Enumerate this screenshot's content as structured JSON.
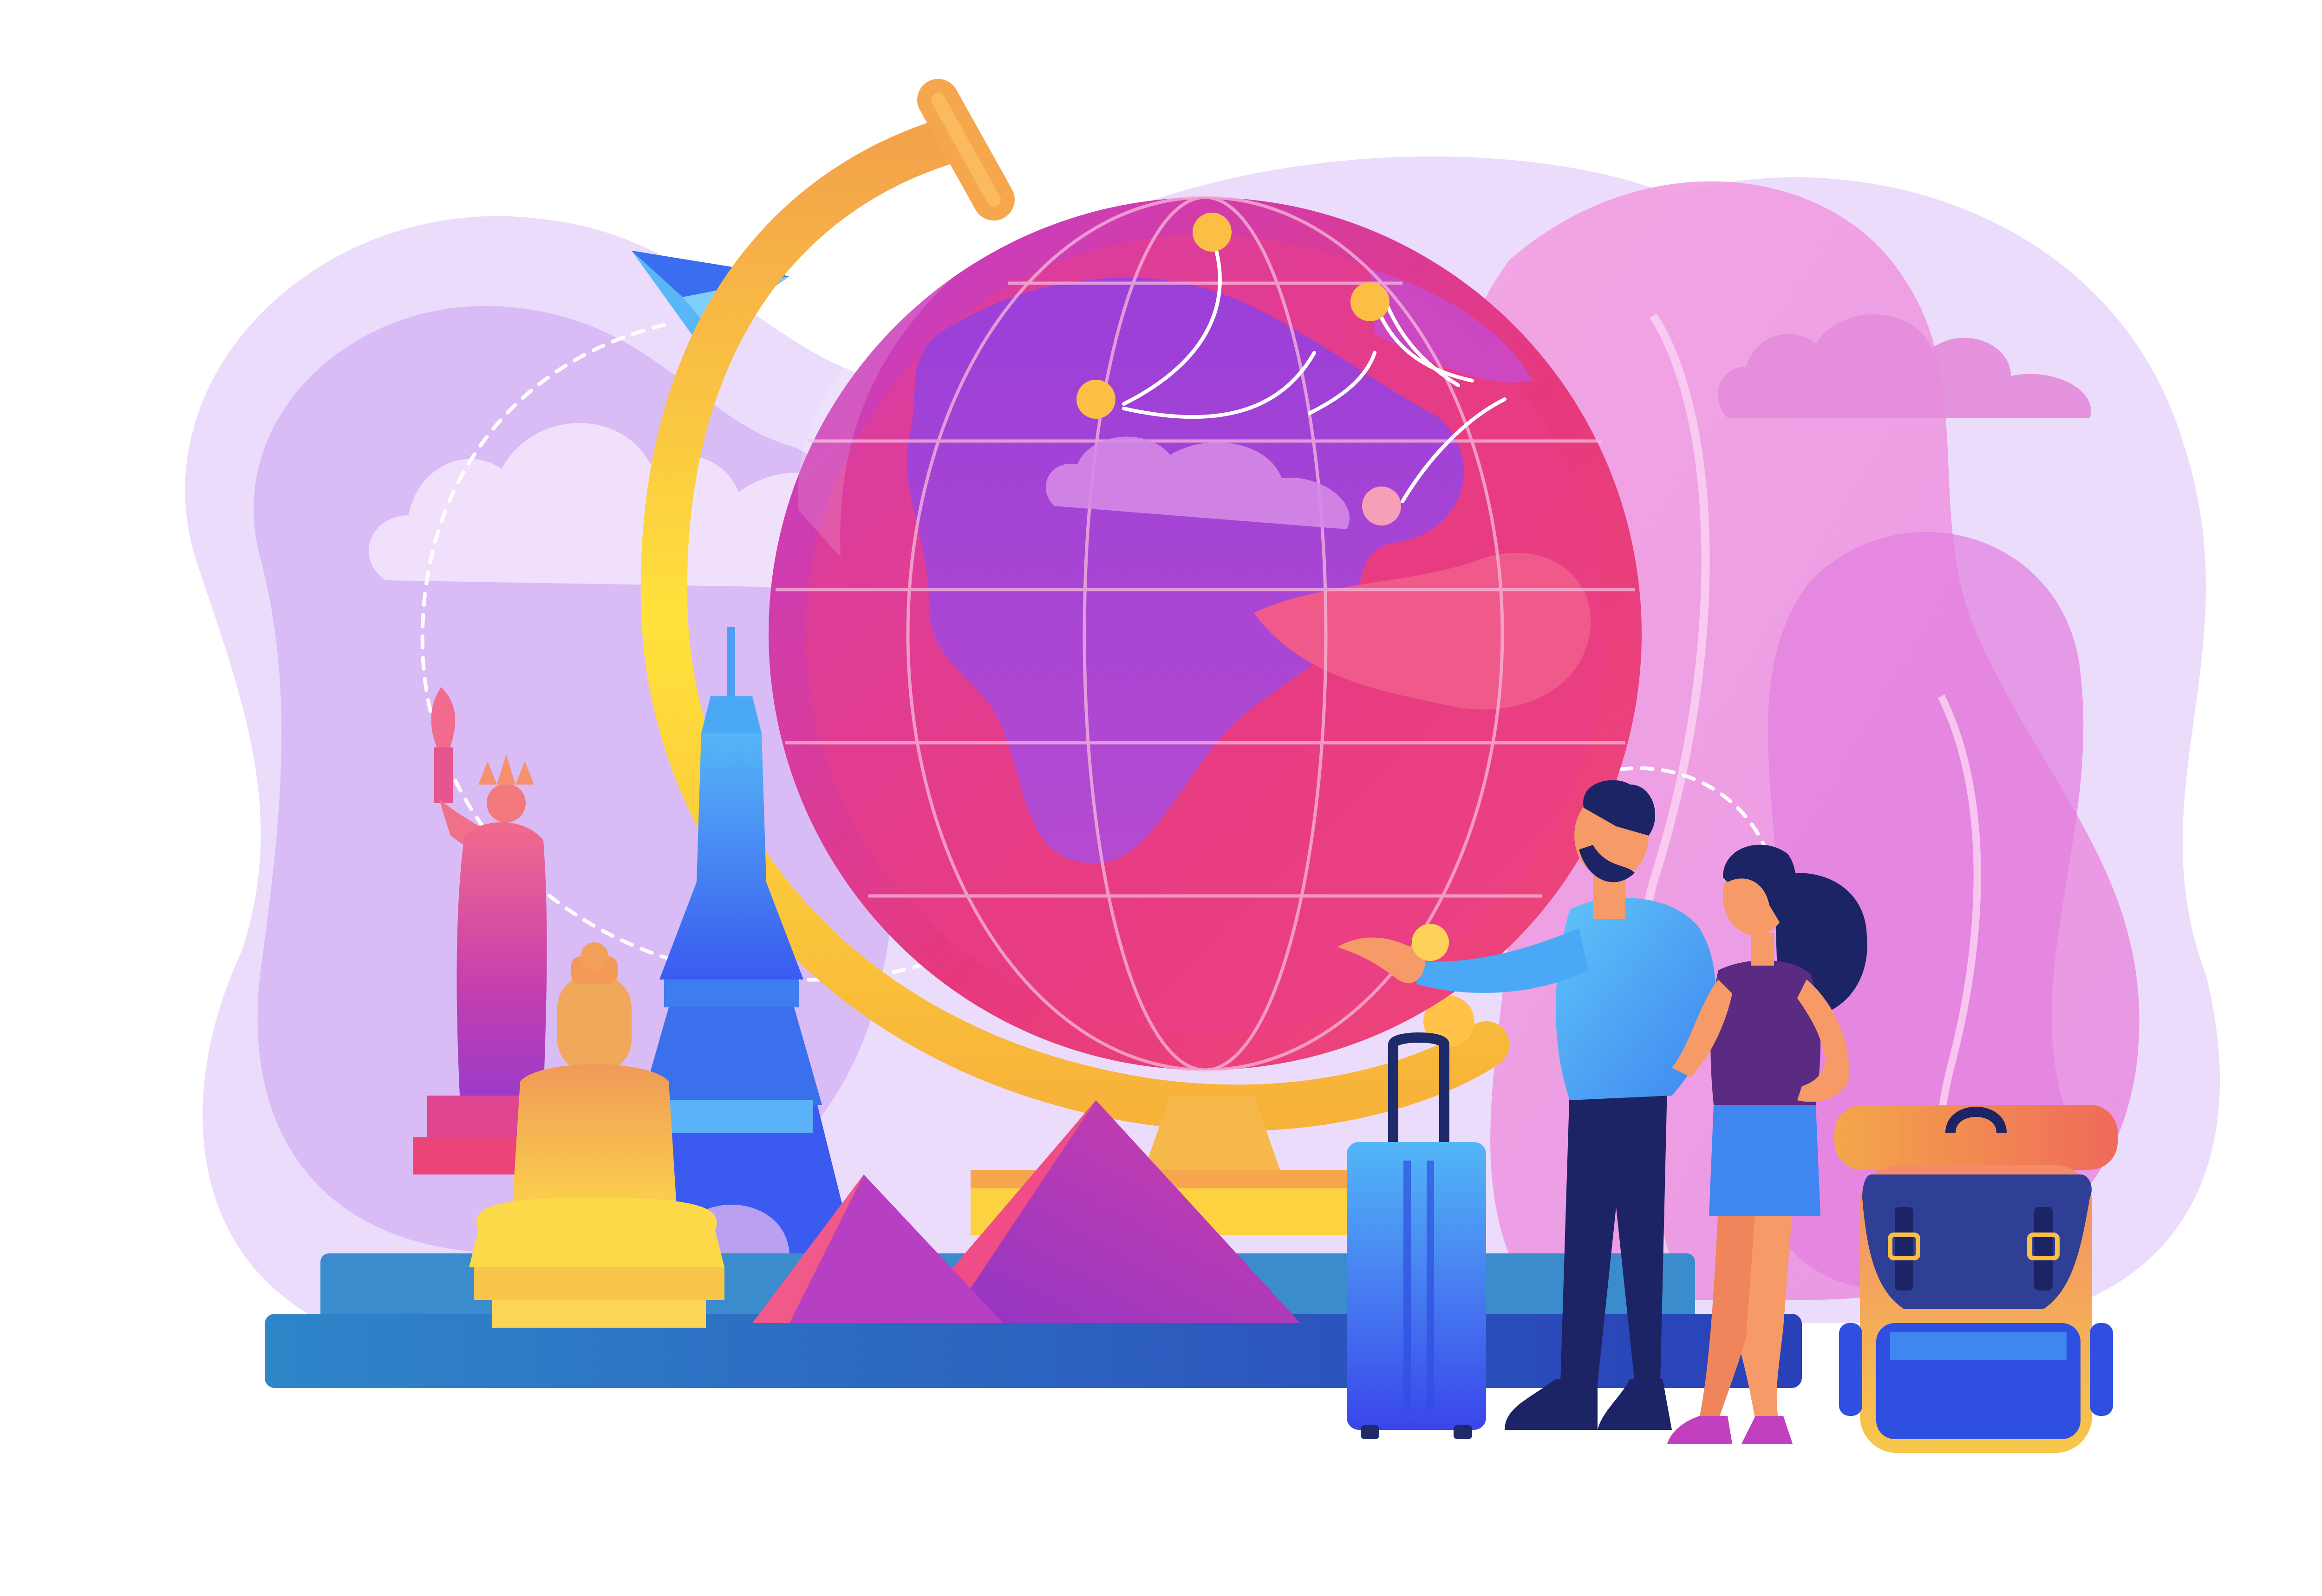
{
  "image": {
    "kind": "flat vector illustration",
    "text_visible": false
  },
  "palette": {
    "background": "#ffffff",
    "haze_lilac": "#dcc1f6",
    "haze_pink": "#f3a6e6",
    "globe_magenta": "#e6397d",
    "globe_violet": "#a945d4",
    "stand_yellow": "#ffe23b",
    "stand_orange": "#f3a24a",
    "platform_blue": "#2e6ac1",
    "skin_orange": "#f69a68",
    "shirt_blue": "#4aa8f7",
    "trousers_navy": "#1c2466",
    "suitcase_blue": "#3a65f0"
  },
  "scene": {
    "elements": [
      "background-haze",
      "clouds",
      "paper-plane",
      "globe",
      "globe-stand",
      "flight-route-dots",
      "statue-of-liberty",
      "eiffel-tower",
      "buddha-statue",
      "pyramids",
      "platform",
      "suitcase",
      "traveler-man",
      "traveler-woman",
      "backpack"
    ]
  }
}
